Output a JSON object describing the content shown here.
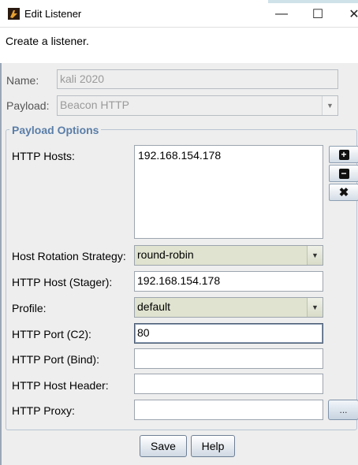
{
  "window": {
    "title": "Edit Listener",
    "controls": {
      "minimize": "—",
      "maximize": "☐",
      "close": "✕"
    }
  },
  "description": "Create a listener.",
  "form": {
    "name_label": "Name:",
    "name_value": "kali 2020",
    "payload_label": "Payload:",
    "payload_value": "Beacon HTTP",
    "group_title": "Payload Options",
    "http_hosts_label": "HTTP Hosts:",
    "http_hosts_value": "192.168.154.178",
    "rotation_label": "Host Rotation Strategy:",
    "rotation_value": "round-robin",
    "stager_label": "HTTP Host (Stager):",
    "stager_value": "192.168.154.178",
    "profile_label": "Profile:",
    "profile_value": "default",
    "port_c2_label": "HTTP Port (C2):",
    "port_c2_value": "80",
    "port_bind_label": "HTTP Port (Bind):",
    "port_bind_value": "",
    "host_header_label": "HTTP Host Header:",
    "host_header_value": "",
    "proxy_label": "HTTP Proxy:",
    "proxy_value": "",
    "proxy_button": "...",
    "add_icon": "+",
    "remove_icon": "−",
    "clear_icon": "✖"
  },
  "buttons": {
    "save": "Save",
    "help": "Help"
  },
  "icons": {
    "app": "cobalt-strike-app-icon",
    "add": "plus-icon",
    "remove": "minus-icon",
    "clear": "x-icon"
  }
}
